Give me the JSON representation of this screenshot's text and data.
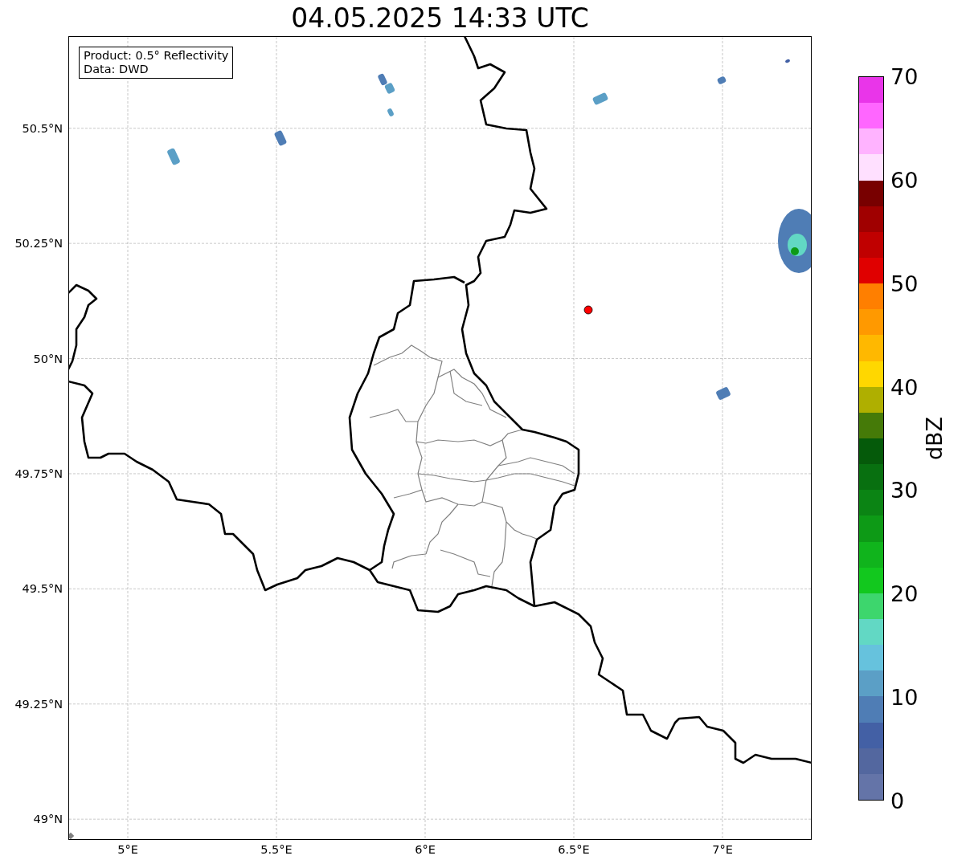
{
  "title": "04.05.2025 14:33 UTC",
  "info_box": [
    "Product: 0.5° Reflectivity",
    "Data: DWD"
  ],
  "map": {
    "x_ticks": [
      "5°E",
      "5.5°E",
      "6°E",
      "6.5°E",
      "7°E"
    ],
    "y_ticks": [
      "50.5°N",
      "50.25°N",
      "50°N",
      "49.75°N",
      "49.5°N",
      "49.25°N",
      "49°N"
    ]
  },
  "colorbar": {
    "label": "dBZ",
    "ticks": [
      "70",
      "60",
      "50",
      "40",
      "30",
      "20",
      "10",
      "0"
    ],
    "bins": [
      {
        "color": "#e935e9"
      },
      {
        "color": "#ff66ff"
      },
      {
        "color": "#ffb3ff"
      },
      {
        "color": "#ffe0ff"
      },
      {
        "color": "#780000"
      },
      {
        "color": "#a00000"
      },
      {
        "color": "#c00000"
      },
      {
        "color": "#e00000"
      },
      {
        "color": "#ff7f00"
      },
      {
        "color": "#ff9900"
      },
      {
        "color": "#ffb800"
      },
      {
        "color": "#ffd700"
      },
      {
        "color": "#afaf00"
      },
      {
        "color": "#457a08"
      },
      {
        "color": "#055a0a"
      },
      {
        "color": "#087010"
      },
      {
        "color": "#0b8414"
      },
      {
        "color": "#0d9a16"
      },
      {
        "color": "#10b41c"
      },
      {
        "color": "#12c81e"
      },
      {
        "color": "#3dd66d"
      },
      {
        "color": "#62d8c4"
      },
      {
        "color": "#66c2dd"
      },
      {
        "color": "#5b9fc6"
      },
      {
        "color": "#4f7db5"
      },
      {
        "color": "#4360a5"
      },
      {
        "color": "#53679f"
      },
      {
        "color": "#6474a8"
      }
    ]
  }
}
